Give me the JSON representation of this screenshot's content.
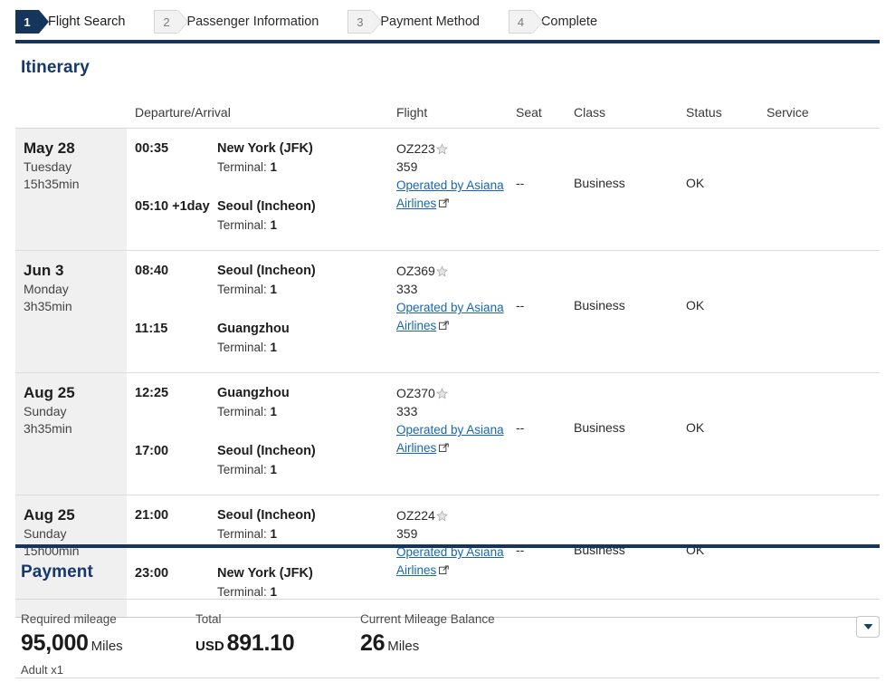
{
  "steps": [
    {
      "num": "1",
      "label": "Flight Search",
      "state": "active"
    },
    {
      "num": "2",
      "label": "Passenger Information",
      "state": "inactive"
    },
    {
      "num": "3",
      "label": "Payment Method",
      "state": "inactive"
    },
    {
      "num": "4",
      "label": "Complete",
      "state": "inactive"
    }
  ],
  "itinerary": {
    "title": "Itinerary",
    "columns": {
      "date": "",
      "departure_arrival": "Departure/Arrival",
      "flight": "Flight",
      "seat": "Seat",
      "class": "Class",
      "status": "Status",
      "service": "Service"
    },
    "rows": [
      {
        "date": "May 28",
        "weekday": "Tuesday",
        "duration": "15h35min",
        "dep_time": "00:35",
        "dep_day_offset": "",
        "dep_place": "New York (JFK)",
        "dep_terminal_label": "Terminal: ",
        "dep_terminal": "1",
        "arr_time": "05:10",
        "arr_day_offset": "+1day",
        "arr_place": "Seoul (Incheon)",
        "arr_terminal_label": "Terminal: ",
        "arr_terminal": "1",
        "flight_no": "OZ223",
        "equipment": "359",
        "operated_by": "Operated by Asiana Airlines",
        "seat": "--",
        "class": "Business",
        "status": "OK",
        "service": ""
      },
      {
        "date": "Jun 3",
        "weekday": "Monday",
        "duration": "3h35min",
        "dep_time": "08:40",
        "dep_day_offset": "",
        "dep_place": "Seoul (Incheon)",
        "dep_terminal_label": "Terminal: ",
        "dep_terminal": "1",
        "arr_time": "11:15",
        "arr_day_offset": "",
        "arr_place": "Guangzhou",
        "arr_terminal_label": "Terminal: ",
        "arr_terminal": "1",
        "flight_no": "OZ369",
        "equipment": "333",
        "operated_by": "Operated by Asiana Airlines",
        "seat": "--",
        "class": "Business",
        "status": "OK",
        "service": ""
      },
      {
        "date": "Aug 25",
        "weekday": "Sunday",
        "duration": "3h35min",
        "dep_time": "12:25",
        "dep_day_offset": "",
        "dep_place": "Guangzhou",
        "dep_terminal_label": "Terminal: ",
        "dep_terminal": "1",
        "arr_time": "17:00",
        "arr_day_offset": "",
        "arr_place": "Seoul (Incheon)",
        "arr_terminal_label": "Terminal: ",
        "arr_terminal": "1",
        "flight_no": "OZ370",
        "equipment": "333",
        "operated_by": "Operated by Asiana Airlines",
        "seat": "--",
        "class": "Business",
        "status": "OK",
        "service": ""
      },
      {
        "date": "Aug 25",
        "weekday": "Sunday",
        "duration": "15h00min",
        "dep_time": "21:00",
        "dep_day_offset": "",
        "dep_place": "Seoul (Incheon)",
        "dep_terminal_label": "Terminal: ",
        "dep_terminal": "1",
        "arr_time": "23:00",
        "arr_day_offset": "",
        "arr_place": "New York (JFK)",
        "arr_terminal_label": "Terminal: ",
        "arr_terminal": "1",
        "flight_no": "OZ224",
        "equipment": "359",
        "operated_by": "Operated by Asiana Airlines",
        "seat": "--",
        "class": "Business",
        "status": "OK",
        "service": ""
      }
    ]
  },
  "payment": {
    "title": "Payment",
    "required_mileage_label": "Required mileage",
    "required_mileage_value": "95,000",
    "required_mileage_unit": "Miles",
    "required_mileage_sub": "Adult x1",
    "total_label": "Total",
    "total_currency": "USD",
    "total_value": "891.10",
    "balance_label": "Current Mileage Balance",
    "balance_value": "26",
    "balance_unit": "Miles",
    "toggle_icon": "chevron-down-icon"
  },
  "colors": {
    "navy": "#16355c",
    "heading_blue": "#17386b",
    "link_blue": "#1767b0",
    "row_date_bg": "#f0f0f0",
    "star_grey": "#b8b8b8"
  }
}
